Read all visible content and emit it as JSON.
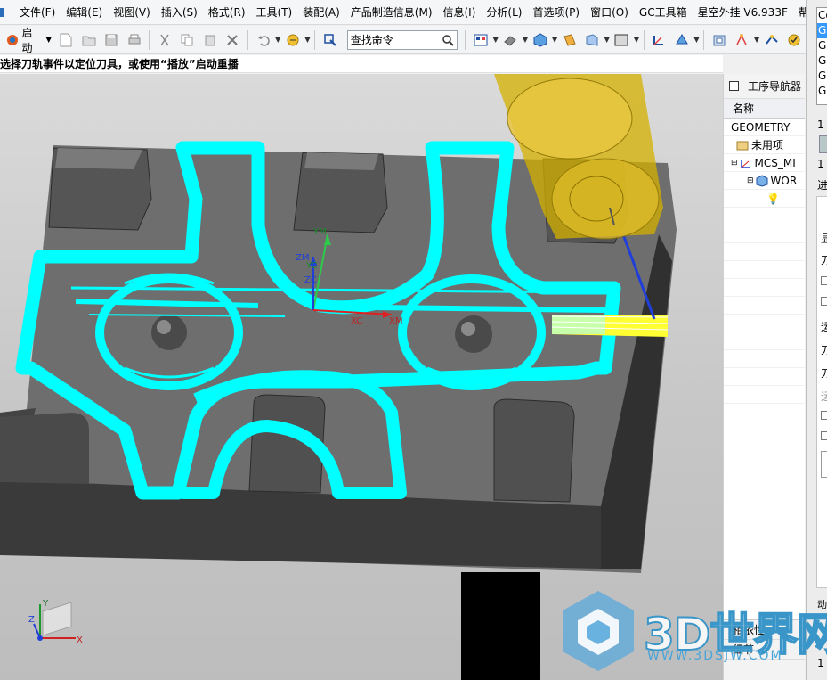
{
  "menubar": {
    "items": [
      "文件(F)",
      "编辑(E)",
      "视图(V)",
      "插入(S)",
      "格式(R)",
      "工具(T)",
      "装配(A)",
      "产品制造信息(M)",
      "信息(I)",
      "分析(L)",
      "首选项(P)",
      "窗口(O)",
      "GC工具箱",
      "星空外挂 V6.933F",
      "帮助(H)"
    ]
  },
  "toolbar": {
    "start_label": "启动",
    "command_search_placeholder": "查找命令"
  },
  "cue_line": "选择刀轨事件以定位刀具，或使用“播放”启动重播",
  "viewport": {
    "axis_labels": {
      "ym": "YM",
      "yc": "YC",
      "zm": "ZM",
      "zc": "ZC",
      "xc": "XC",
      "xm": "XM"
    },
    "triad_labels": {
      "x": "X",
      "y": "Y",
      "z": "Z"
    },
    "colors": {
      "toolpath": "#00ffff",
      "part_top": "#7a7a7a",
      "part_side": "#3a3a3a",
      "tool_holder": "#d4b000"
    }
  },
  "navigator": {
    "title": "工序导航器",
    "column_header": "名称",
    "view": "GEOMETRY",
    "nodes": [
      "未用项",
      "MCS_MI",
      "WOR"
    ],
    "bottom_sections": [
      "相依性",
      "细节"
    ]
  },
  "right_panel": {
    "operation_list": [
      "Co",
      "GC",
      "GC",
      "GC",
      "GC",
      "GC"
    ],
    "labels": {
      "count_top": "1",
      "count_row": "1",
      "progress": "进给",
      "display": "显",
      "tool_a": "刀",
      "motion": "运",
      "tool_b": "刀",
      "tool_c": "刀",
      "motion_b": "运",
      "animation": "动画",
      "count_bottom": "1"
    }
  },
  "watermark": {
    "text": "3D世界网",
    "url": "WWW.3DSJW.COM"
  }
}
